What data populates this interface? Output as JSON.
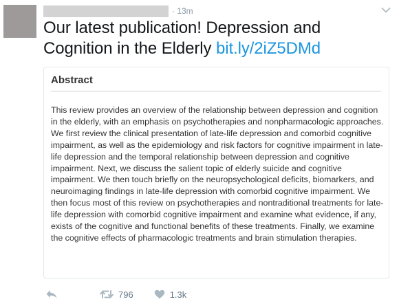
{
  "tweet": {
    "time": "· 13m",
    "text": "Our latest publication! Depression and Cognition in the Elderly ",
    "link": "bit.ly/2iZ5DMd"
  },
  "card": {
    "heading": "Abstract",
    "body": "This review provides an overview of the relationship between depression and cognition in the elderly, with an emphasis on psychotherapies and nonpharmacologic approaches. We first review the clinical presentation of late-life depression and comorbid cognitive impairment, as well as the epidemiology and risk factors for cognitive impairment in late-life depression and the temporal relationship between depression and cognitive impairment. Next, we discuss the salient topic of elderly suicide and cognitive impairment. We then touch briefly on the neuropsychological deficits, biomarkers, and neuroimaging findings in late-life depression with comorbid cognitive impairment. We then focus most of this review on psychotherapies and nontraditional treatments for late-life depression with comorbid cognitive impairment and examine what evidence, if any, exists of the cognitive and functional benefits of these treatments. Finally, we examine the cognitive effects of pharmacologic treatments and brain stimulation therapies."
  },
  "actions": {
    "retweets": "796",
    "likes": "1.3k"
  },
  "icons": {
    "reply": "reply-icon",
    "retweet": "retweet-icon",
    "like": "heart-icon",
    "menu": "chevron-down-icon"
  },
  "colors": {
    "link": "#1b95e0",
    "muted": "#8899a6",
    "action": "#657786"
  }
}
